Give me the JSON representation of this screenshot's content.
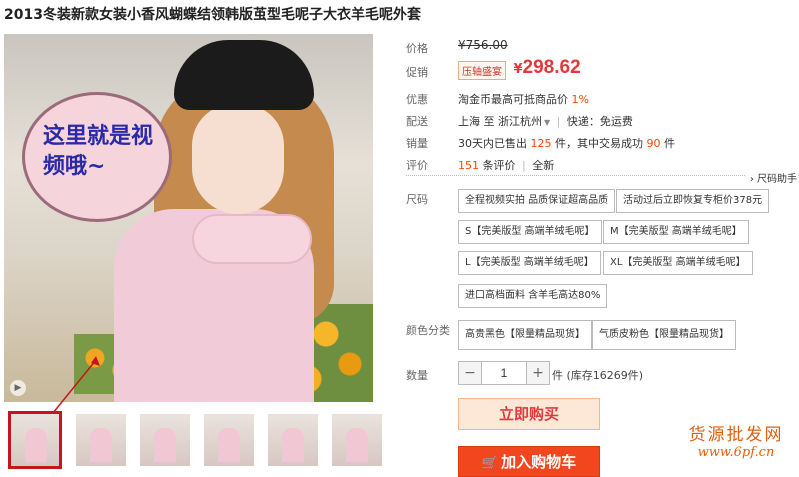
{
  "product": {
    "title": "2013冬装新款女装小香风蝴蝶结领韩版茧型毛呢子大衣羊毛呢外套"
  },
  "media": {
    "bubble_text": "这里就是视频哦~",
    "play_icon": "play-icon",
    "thumbnail_count": 6,
    "active_thumbnail": 1
  },
  "price": {
    "label": "价格",
    "original": "¥756.00",
    "promo_label": "促销",
    "promo_badge": "压轴盛宴",
    "currency": "¥",
    "current": "298.62"
  },
  "benefit": {
    "label": "优惠",
    "text": "淘金币最高可抵商品价",
    "percent": "1%"
  },
  "shipping": {
    "label": "配送",
    "from": "上海",
    "to_word": "至",
    "destination": "浙江杭州",
    "dropdown_icon": "chevron-down-icon",
    "express": "快递：免运费"
  },
  "sales": {
    "label": "销量",
    "prefix": "30天内已售出",
    "sold": "125",
    "middle": "件，其中交易成功",
    "success": "90",
    "suffix": "件"
  },
  "reviews": {
    "label": "评价",
    "count": "151",
    "count_suffix": "条评价",
    "all_label": "全新"
  },
  "size_helper": "尺码助手",
  "sizes": {
    "label": "尺码",
    "options": [
      "全程视频实拍 品质保证超高品质",
      "活动过后立即恢复专柜价378元",
      "S【完美版型 高端羊绒毛呢】",
      "M【完美版型 高端羊绒毛呢】",
      "L【完美版型 高端羊绒毛呢】",
      "XL【完美版型 高端羊绒毛呢】",
      "进口高档面料 含羊毛高达80%"
    ]
  },
  "colors": {
    "label": "颜色分类",
    "options": [
      "高贵黑色【限量精品现货】",
      "气质皮粉色【限量精品现货】"
    ]
  },
  "quantity": {
    "label": "数量",
    "minus": "−",
    "value": "1",
    "plus": "+",
    "stock": "件 (库存16269件)"
  },
  "actions": {
    "buy_now": "立即购买",
    "add_cart": "加入购物车",
    "cart_icon": "cart-icon"
  },
  "watermark": {
    "line1": "货源批发网",
    "line2": "www.6pf.cn"
  },
  "colors_theme": {
    "price_red": "#e4393c",
    "accent_orange": "#f40",
    "cart_button": "#f2461e",
    "active_thumb_border": "#c4161c"
  }
}
